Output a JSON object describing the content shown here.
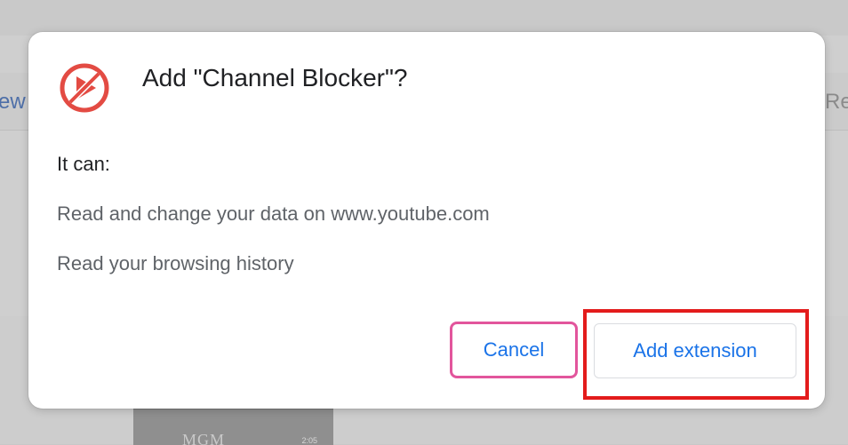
{
  "background": {
    "left_tab_fragment": "ew",
    "right_tab_fragment": "Re",
    "thumbnail_logo": "MGM",
    "thumbnail_time": "2:05"
  },
  "dialog": {
    "title": "Add \"Channel Blocker\"?",
    "icon": "channel-blocker-icon",
    "permissions_heading": "It can:",
    "permissions": [
      "Read and change your data on www.youtube.com",
      "Read your browsing history"
    ],
    "cancel_label": "Cancel",
    "add_label": "Add extension"
  },
  "colors": {
    "accent": "#1a73e8",
    "icon_red": "#e34b43",
    "cancel_outline": "#e2559c",
    "highlight_red": "#e31b1b"
  }
}
